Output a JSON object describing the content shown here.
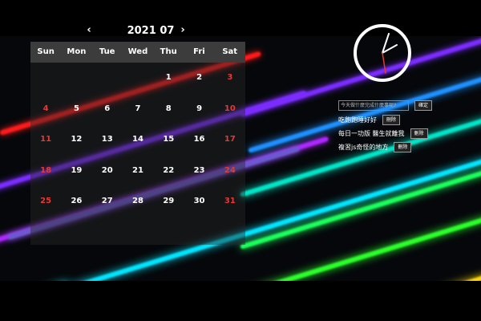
{
  "calendar": {
    "year": "2021",
    "month": "07",
    "prev_icon": "chevron-left-icon",
    "next_icon": "chevron-right-icon",
    "prev_glyph": "‹",
    "next_glyph": "›",
    "weekdays": [
      "Sun",
      "Mon",
      "Tue",
      "Wed",
      "Thu",
      "Fri",
      "Sat"
    ],
    "weeks": [
      [
        "",
        "",
        "",
        "",
        "1",
        "2",
        "3"
      ],
      [
        "4",
        "5",
        "6",
        "7",
        "8",
        "9",
        "10"
      ],
      [
        "11",
        "12",
        "13",
        "14",
        "15",
        "16",
        "17"
      ],
      [
        "18",
        "19",
        "20",
        "21",
        "22",
        "23",
        "24"
      ],
      [
        "25",
        "26",
        "27",
        "28",
        "29",
        "30",
        "31"
      ]
    ],
    "weekend_color": "#e53935"
  },
  "clock": {
    "face_color": "#ffffff",
    "second_hand_color": "#e53935"
  },
  "todo": {
    "placeholder": "今天做什麼完成什麼事呢?",
    "confirm_label": "確定",
    "delete_label": "刪除",
    "items": [
      "吃飽飽睡好好",
      "每日一功版 醫生就離我",
      "複習js奇怪的地方"
    ]
  },
  "background": {
    "stripe_colors": [
      "#ff1a1a",
      "#8a2be2",
      "#a020f0",
      "#1e90ff",
      "#00e5ff",
      "#00ff7f",
      "#39ff14",
      "#ffd700"
    ]
  }
}
